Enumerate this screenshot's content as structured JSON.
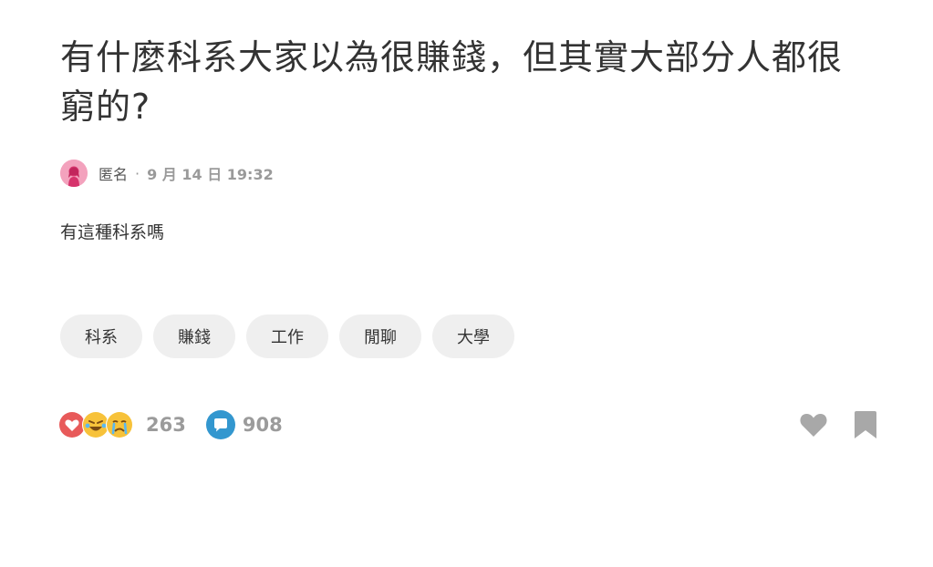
{
  "post": {
    "title": "有什麼科系大家以為很賺錢，但其實大部分人都很窮的?",
    "author": "匿名",
    "separator": "·",
    "timestamp": "9 月 14 日 19:32",
    "content": "有這種科系嗎"
  },
  "tags": [
    "科系",
    "賺錢",
    "工作",
    "閒聊",
    "大學"
  ],
  "stats": {
    "reaction_icons": [
      "heart-icon",
      "laugh-emoji-icon",
      "cry-emoji-icon"
    ],
    "reaction_count": "263",
    "comment_count": "908"
  },
  "colors": {
    "heart": "#e85a5a",
    "comment": "#3397cf",
    "tag_bg": "#efefef",
    "muted": "#9b9b9b",
    "avatar": "#f3a2bd"
  }
}
